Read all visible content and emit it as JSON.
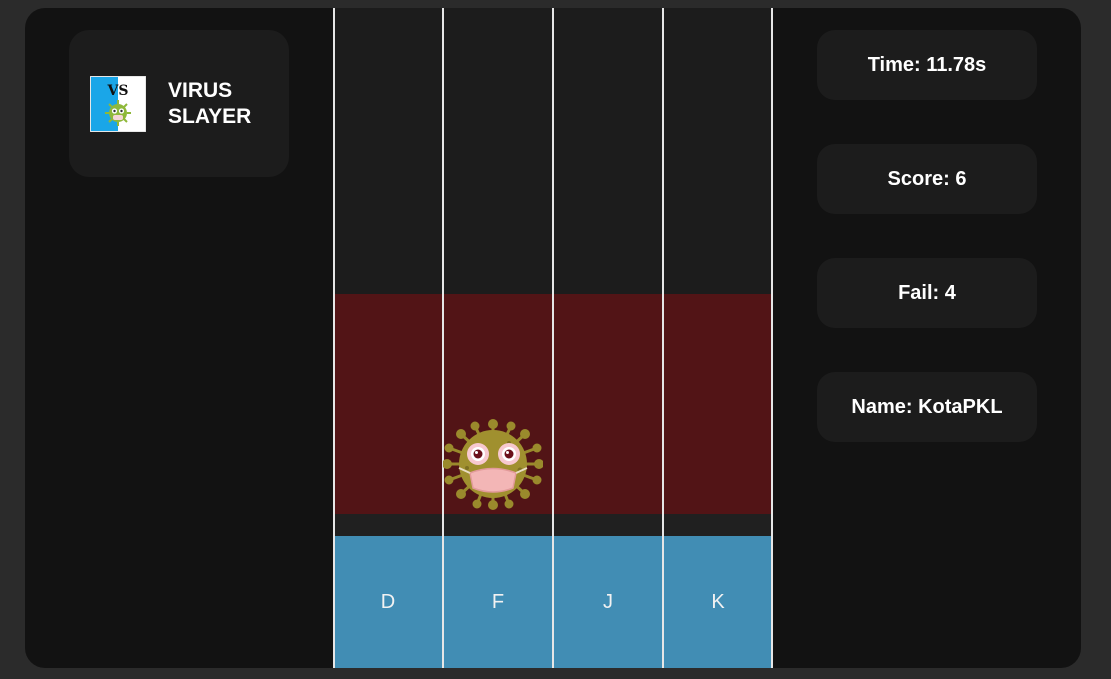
{
  "brand": {
    "logo_icon": "vs-virus-logo-icon",
    "logo_text": "VS",
    "title": "VIRUS SLAYER"
  },
  "stats": {
    "time": "Time: 11.78s",
    "score": "Score: 6",
    "fail": "Fail: 4",
    "name": "Name: KotaPKL"
  },
  "lanes": {
    "keys": [
      "D",
      "F",
      "J",
      "K"
    ]
  },
  "enemy": {
    "icon": "masked-virus-icon",
    "lane": "F"
  },
  "colors": {
    "frame": "#121212",
    "card": "#1c1c1c",
    "danger_zone": "#521416",
    "key_row": "#418db4",
    "lane_line": "#e6e6e6",
    "virus_body": "#9a8a2c",
    "mask": "#f3b6b6"
  }
}
